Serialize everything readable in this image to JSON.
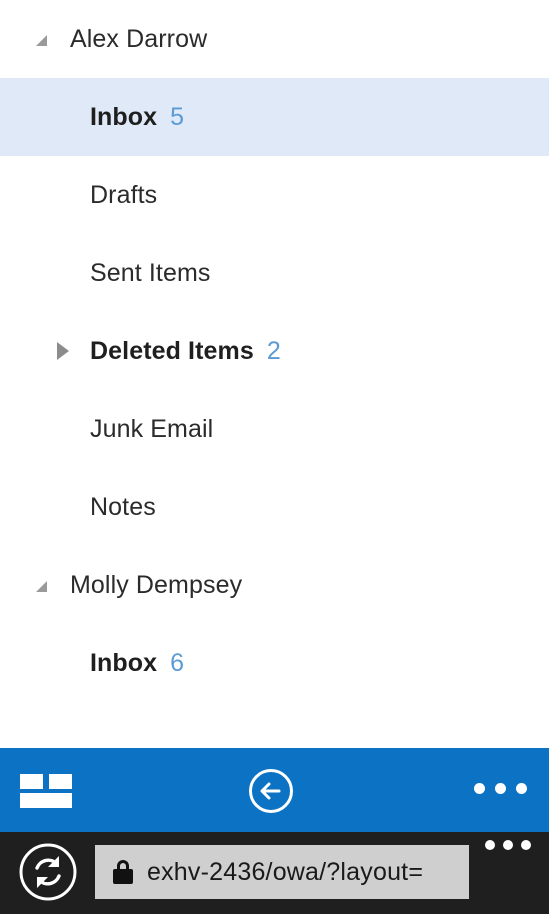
{
  "colors": {
    "selected_row_bg": "#dfe9f7",
    "count_blue": "#5b9bd5",
    "appbar_blue": "#0b72c4",
    "browserbar_dark": "#1f1f1f",
    "urlbar_bg": "#cfcfcf",
    "text_dark": "#2b2b2b",
    "twisty_gray": "#9a9a9a"
  },
  "folder_pane": {
    "groups": [
      {
        "account": "Alex Darrow",
        "expanded": true,
        "twisty": "triangle-expanded-icon",
        "folders": [
          {
            "label": "Inbox",
            "count": "5",
            "bold": true,
            "selected": true,
            "twisty": null
          },
          {
            "label": "Drafts",
            "count": "",
            "bold": false,
            "selected": false,
            "twisty": null
          },
          {
            "label": "Sent Items",
            "count": "",
            "bold": false,
            "selected": false,
            "twisty": null
          },
          {
            "label": "Deleted Items",
            "count": "2",
            "bold": true,
            "selected": false,
            "twisty": "triangle-collapsed-icon"
          },
          {
            "label": "Junk Email",
            "count": "",
            "bold": false,
            "selected": false,
            "twisty": null
          },
          {
            "label": "Notes",
            "count": "",
            "bold": false,
            "selected": false,
            "twisty": null
          }
        ]
      },
      {
        "account": "Molly Dempsey",
        "expanded": true,
        "twisty": "triangle-expanded-icon",
        "folders": [
          {
            "label": "Inbox",
            "count": "6",
            "bold": true,
            "selected": false,
            "twisty": null
          }
        ]
      }
    ]
  },
  "appbar": {
    "tiles_icon": "layout-tiles-icon",
    "back_icon": "back-arrow-circle-icon",
    "more_icon": "more-ellipsis-icon"
  },
  "browserbar": {
    "refresh_icon": "refresh-circle-icon",
    "lock_icon": "lock-icon",
    "url": "exhv-2436/owa/?layout=",
    "more_icon": "more-ellipsis-icon"
  }
}
